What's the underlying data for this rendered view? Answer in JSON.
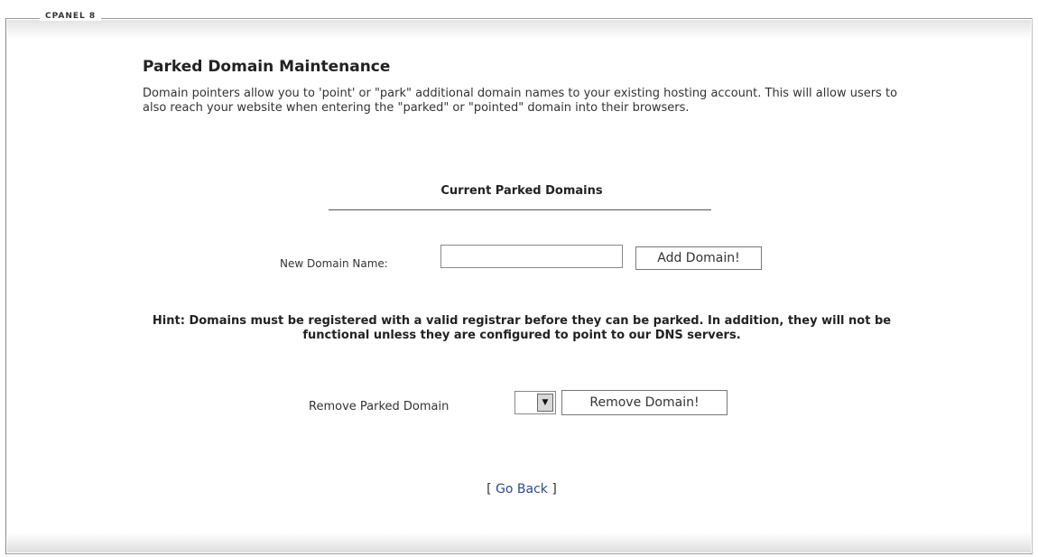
{
  "header": {
    "brand": "CPANEL 8"
  },
  "page": {
    "title": "Parked Domain Maintenance",
    "description": "Domain pointers allow you to 'point' or \"park\" additional domain names to your existing hosting account. This will allow users to also reach your website when entering the \"parked\" or \"pointed\" domain into their browsers."
  },
  "current": {
    "heading": "Current Parked Domains",
    "domains": []
  },
  "add_form": {
    "label": "New Domain Name:",
    "input_value": "",
    "button_label": "Add Domain!"
  },
  "hint": {
    "text": "Hint: Domains must be registered with a valid registrar before they can be parked. In addition, they will not be functional unless they are configured to point to our DNS servers."
  },
  "remove_form": {
    "label": "Remove Parked Domain",
    "selected_value": "",
    "arrow_icon": "chevron-down-icon",
    "button_label": "Remove Domain!"
  },
  "nav": {
    "go_back_open": "[ ",
    "go_back_label": "Go Back",
    "go_back_close": " ]"
  }
}
